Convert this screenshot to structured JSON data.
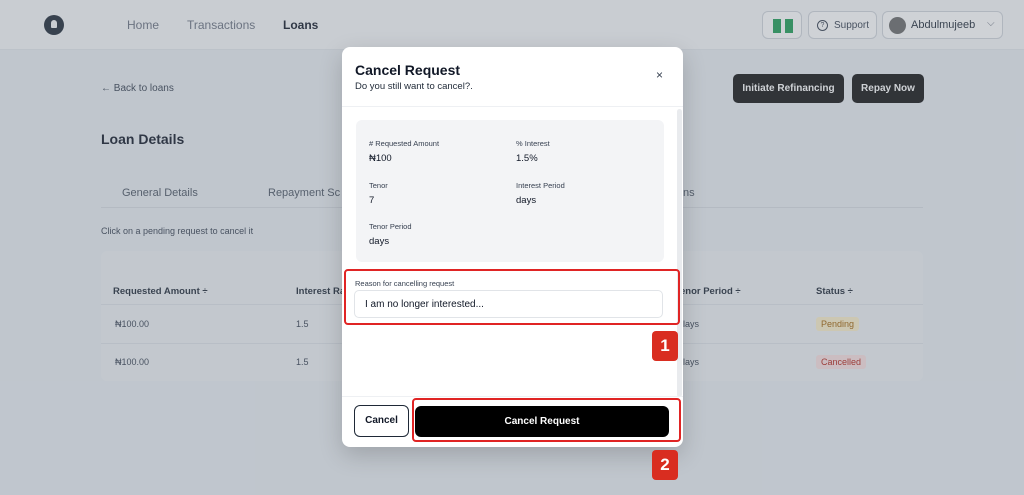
{
  "nav": {
    "home": "Home",
    "transactions": "Transactions",
    "loans": "Loans"
  },
  "header": {
    "support": "Support",
    "user_name": "Abdulmujeeb",
    "chevron": "⌵"
  },
  "page": {
    "back_link": "← Back to loans",
    "initiate_refinancing": "Initiate Refinancing",
    "repay_now": "Repay Now",
    "title": "Loan Details",
    "tabs": [
      "General Details",
      "Repayment Sc",
      "ns"
    ],
    "hint": "Click on a pending request to cancel it"
  },
  "table": {
    "headers": [
      "Requested Amount ÷",
      "Interest Ra",
      "enor Period ÷",
      "Status ÷"
    ],
    "rows": [
      {
        "amount": "₦100.00",
        "interest": "1.5",
        "tenor": "lays",
        "status": "Pending"
      },
      {
        "amount": "₦100.00",
        "interest": "1.5",
        "tenor": "lays",
        "status": "Cancelled"
      }
    ]
  },
  "modal": {
    "title": "Cancel Request",
    "subtitle": "Do you still want to cancel?.",
    "close": "×",
    "fields": {
      "requested_amount_label": "# Requested Amount",
      "requested_amount_value": "₦100",
      "interest_label": "% Interest",
      "interest_value": "1.5%",
      "tenor_label": "Tenor",
      "tenor_value": "7",
      "interest_period_label": "Interest Period",
      "interest_period_value": "days",
      "tenor_period_label": "Tenor Period",
      "tenor_period_value": "days"
    },
    "reason_label": "Reason for cancelling request",
    "reason_value": "I am no longer interested...",
    "cancel_button": "Cancel",
    "confirm_button": "Cancel Request"
  },
  "annotations": [
    "1",
    "2"
  ],
  "colors": {
    "highlight": "#e02424",
    "badge": "#d92d20",
    "primary_button": "#000000"
  }
}
